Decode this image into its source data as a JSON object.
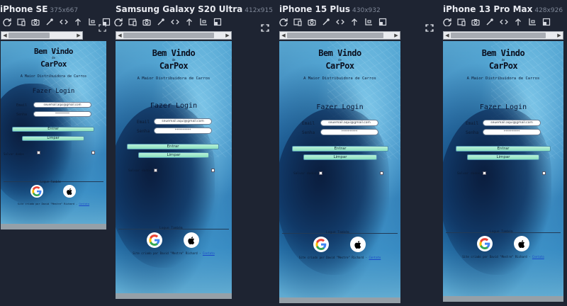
{
  "devices": [
    {
      "name": "iPhone SE",
      "size": "375x667"
    },
    {
      "name": "Samsung Galaxy S20 Ultra",
      "size": "412x915"
    },
    {
      "name": "iPhone 15 Plus",
      "size": "430x932"
    },
    {
      "name": "iPhone 13 Pro Max",
      "size": "428x926"
    }
  ],
  "toolbar_icons": [
    "refresh-icon",
    "responsive-icon",
    "camera-icon",
    "eyedropper-icon",
    "code-icon",
    "arrow-up-icon",
    "layout-icon",
    "crop-icon"
  ],
  "page": {
    "title_line1": "Bem Vindo",
    "title_de": "de",
    "title_line2": "CarPox",
    "subtitle": "A Maior Distribuidora de Carros",
    "login_title": "Fazer Login",
    "email_label": "Email",
    "email_value": "seuemail.aqui@gmail.com",
    "senha_label": "Senha",
    "senha_value": "**********",
    "entrar_label": "Entrar",
    "limpar_label": "Limpar",
    "salvar_dados_label": "Salvar dados",
    "also_label": "Logue Também",
    "footer_text": "Site criado por David \"Mestre\" Richard -",
    "footer_link": "Contato"
  },
  "colors": {
    "background": "#1e2432",
    "button": "#a4e8cc",
    "link": "#1947c9"
  }
}
